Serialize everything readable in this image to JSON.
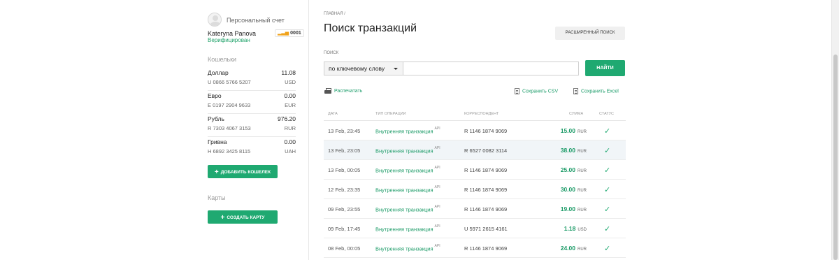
{
  "sidebar": {
    "account_label": "Персональный счет",
    "user_name": "Kateryna Panova",
    "user_status": "Верифицирован",
    "badge_icon": "▂▃▅",
    "badge_text": "0001",
    "wallets_title": "Кошельки",
    "wallets": [
      {
        "name": "Доллар",
        "number": "U 0866 5766 5207",
        "amount": "11.08",
        "currency": "USD"
      },
      {
        "name": "Евро",
        "number": "E 0197 2904 9633",
        "amount": "0.00",
        "currency": "EUR"
      },
      {
        "name": "Рубль",
        "number": "R 7303 4067 3153",
        "amount": "976.20",
        "currency": "RUR"
      },
      {
        "name": "Гривна",
        "number": "H 6892 3425 8115",
        "amount": "0.00",
        "currency": "UAH"
      }
    ],
    "add_wallet_label": "ДОБАВИТЬ КОШЕЛЕК",
    "cards_title": "Карты",
    "create_card_label": "СОЗДАТЬ КАРТУ",
    "plus_icon": "+"
  },
  "main": {
    "breadcrumb": "ГЛАВНАЯ /",
    "title": "Поиск транзакций",
    "advanced_search_label": "РАСШИРЕННЫЙ ПОИСК",
    "search_label": "ПОИСК",
    "search_mode": "по ключевому слову",
    "search_value": "",
    "find_label": "НАЙТИ",
    "print_label": "Распечатать",
    "save_csv_label": "Сохранить CSV",
    "save_excel_label": "Сохранить Excel",
    "table": {
      "headers": {
        "date": "ДАТА",
        "type": "ТИП ОПЕРАЦИИ",
        "correspondent": "КОРРЕСПОНДЕНТ",
        "sum": "СУММА",
        "status": "СТАТУС"
      },
      "rows": [
        {
          "date": "13 Feb, 23:45",
          "type": "Внутренняя транзакция",
          "tag": "API",
          "correspondent": "R 1146 1874 9069",
          "amount": "15.00",
          "currency": "RUR",
          "status": "✓"
        },
        {
          "date": "13 Feb, 23:05",
          "type": "Внутренняя транзакция",
          "tag": "API",
          "correspondent": "R 6527 0082 3114",
          "amount": "38.00",
          "currency": "RUR",
          "status": "✓"
        },
        {
          "date": "13 Feb, 00:05",
          "type": "Внутренняя транзакция",
          "tag": "API",
          "correspondent": "R 1146 1874 9069",
          "amount": "25.00",
          "currency": "RUR",
          "status": "✓"
        },
        {
          "date": "12 Feb, 23:35",
          "type": "Внутренняя транзакция",
          "tag": "API",
          "correspondent": "R 1146 1874 9069",
          "amount": "30.00",
          "currency": "RUR",
          "status": "✓"
        },
        {
          "date": "09 Feb, 23:55",
          "type": "Внутренняя транзакция",
          "tag": "API",
          "correspondent": "R 1146 1874 9069",
          "amount": "19.00",
          "currency": "RUR",
          "status": "✓"
        },
        {
          "date": "09 Feb, 17:45",
          "type": "Внутренняя транзакция",
          "tag": "API",
          "correspondent": "U 5971 2615 4161",
          "amount": "1.18",
          "currency": "USD",
          "status": "✓"
        },
        {
          "date": "08 Feb, 00:05",
          "type": "Внутренняя транзакция",
          "tag": "API",
          "correspondent": "R 1146 1874 9069",
          "amount": "24.00",
          "currency": "RUR",
          "status": "✓"
        }
      ]
    }
  },
  "colors": {
    "accent": "#1fa971",
    "link": "#1a9a66",
    "row_highlight": "#f1f5f8"
  }
}
